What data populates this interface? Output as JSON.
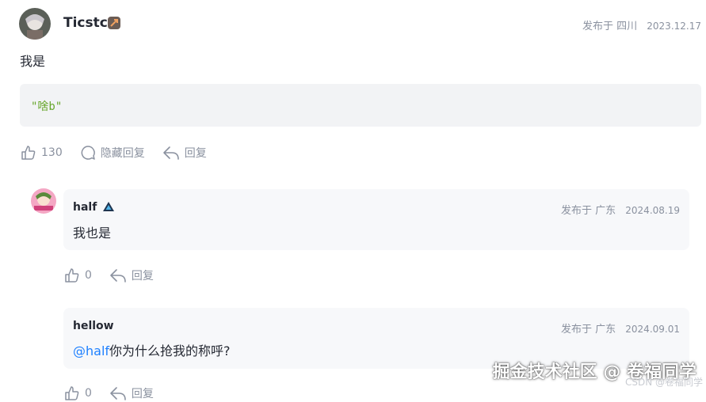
{
  "colors": {
    "accent": "#1e80ff",
    "code_green": "#67a62b",
    "muted": "#8a919f",
    "reply_bg": "#f7f8fa"
  },
  "comment": {
    "author": "Ticstc",
    "location_label": "发布于 四川",
    "date": "2023.12.17",
    "text": "我是",
    "code": "\"啥b\"",
    "actions": {
      "like_count": "130",
      "hide_reply": "隐藏回复",
      "reply": "回复"
    }
  },
  "replies": [
    {
      "author": "half",
      "location_label": "发布于 广东",
      "date": "2024.08.19",
      "text": "我也是",
      "like_count": "0",
      "reply": "回复"
    },
    {
      "author": "hellow",
      "location_label": "发布于 广东",
      "date": "2024.09.01",
      "mention": "@half",
      "text": "你为什么抢我的称呼?",
      "like_count": "0",
      "reply": "回复"
    }
  ],
  "watermark": {
    "main": "掘金技术社区 @ 卷福同学",
    "sub": "CSDN @卷福同学"
  }
}
